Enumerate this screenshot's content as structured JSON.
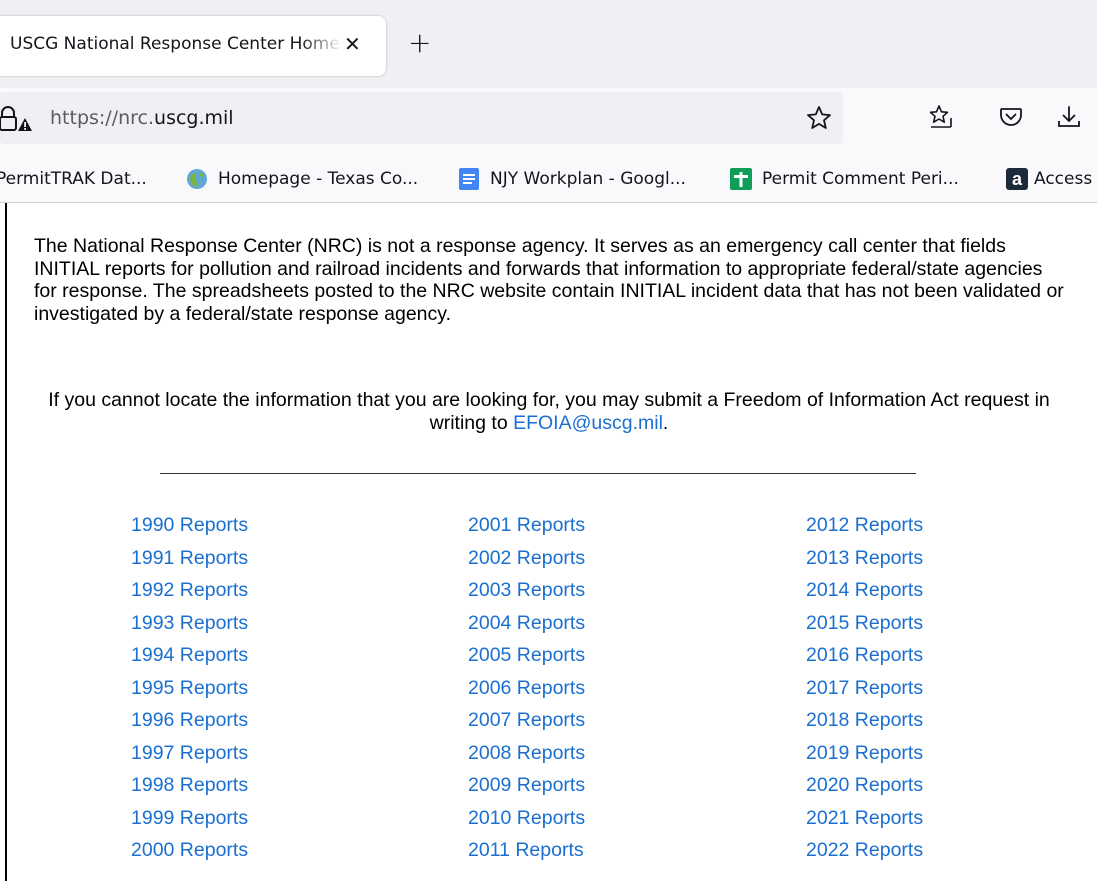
{
  "browser": {
    "tab": {
      "title": "USCG National Response Center Home",
      "close_symbol": "✕"
    },
    "new_tab_symbol": "+",
    "url": {
      "prefix": "https://nrc.",
      "domain": "uscg.mil"
    },
    "bookmarks": [
      {
        "label": "PermitTRAK Dat...",
        "icon": "none"
      },
      {
        "label": "Homepage - Texas Co...",
        "icon": "globe-icon"
      },
      {
        "label": "NJY Workplan - Googl...",
        "icon": "google-docs-icon"
      },
      {
        "label": "Permit Comment Peri...",
        "icon": "google-sheets-icon"
      },
      {
        "label": "Access",
        "icon": "access-icon"
      }
    ]
  },
  "content": {
    "notice": "The National Response Center (NRC) is not a response agency. It serves as an emergency call center that fields INITIAL reports for pollution and railroad incidents and forwards that information to appropriate federal/state agencies for response. The spreadsheets posted to the NRC website contain INITIAL incident data that has not been validated or investigated by a federal/state response agency.",
    "foia_text": "If you cannot locate the information that you are looking for, you may submit a Freedom of Information Act request in writing to",
    "foia_email": "EFOIA@uscg.mil",
    "foia_period": ".",
    "reports": {
      "col1": [
        "1990 Reports",
        "1991 Reports",
        "1992 Reports",
        "1993 Reports",
        "1994 Reports",
        "1995 Reports",
        "1996 Reports",
        "1997 Reports",
        "1998 Reports",
        "1999 Reports",
        "2000 Reports"
      ],
      "col2": [
        "2001 Reports",
        "2002 Reports",
        "2003 Reports",
        "2004 Reports",
        "2005 Reports",
        "2006 Reports",
        "2007 Reports",
        "2008 Reports",
        "2009 Reports",
        "2010 Reports",
        "2011 Reports"
      ],
      "col3": [
        "2012 Reports",
        "2013 Reports",
        "2014 Reports",
        "2015 Reports",
        "2016 Reports",
        "2017 Reports",
        "2018 Reports",
        "2019 Reports",
        "2020 Reports",
        "2021 Reports",
        "2022 Reports"
      ]
    }
  },
  "colors": {
    "link": "#1a6fd0",
    "chrome": "#f0f0f4"
  }
}
